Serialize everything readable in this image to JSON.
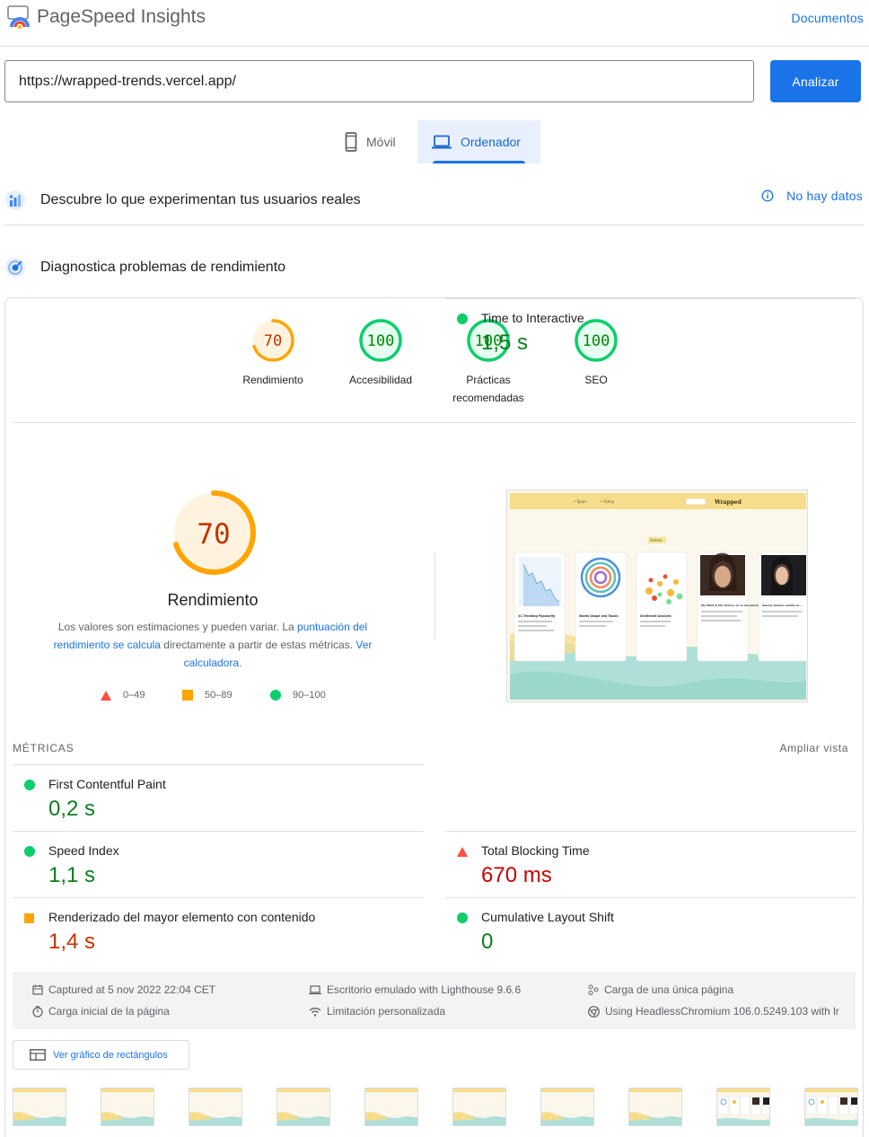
{
  "header": {
    "brand": "PageSpeed Insights",
    "docs_link": "Documentos",
    "colors": {
      "brand_blue": "#1a73e8"
    }
  },
  "search": {
    "url_value": "https://wrapped-trends.vercel.app/",
    "analyze_label": "Analizar"
  },
  "device_tabs": [
    {
      "label": "Móvil",
      "icon": "smartphone-icon",
      "selected": false
    },
    {
      "label": "Ordenador",
      "icon": "laptop-icon",
      "selected": true
    }
  ],
  "field_data": {
    "title": "Descubre lo que experimentan tus usuarios reales",
    "status": "No hay datos",
    "icon": "users-icon"
  },
  "lab_section": {
    "title": "Diagnostica problemas de rendimiento",
    "icon": "gauge-icon"
  },
  "categories": [
    {
      "score": "70",
      "label": "Rendimiento",
      "value": 70,
      "color": "#ffa400"
    },
    {
      "score": "100",
      "label": "Accesibilidad",
      "value": 100,
      "color": "#0cce6b"
    },
    {
      "score": "100",
      "label": "Prácticas recomendadas",
      "value": 100,
      "color": "#0cce6b"
    },
    {
      "score": "100",
      "label": "SEO",
      "value": 100,
      "color": "#0cce6b"
    }
  ],
  "performance": {
    "score": "70",
    "title": "Rendimiento",
    "desc_pre": "Los valores son estimaciones y pueden variar. La ",
    "desc_link1": "puntuación del rendimiento se calcula",
    "desc_mid": " directamente a partir de estas métricas. ",
    "desc_link2": "Ver calculadora.",
    "legend": [
      "0–49",
      "50–89",
      "90–100"
    ]
  },
  "metrics": {
    "title": "MÉTRICAS",
    "expand_label": "Ampliar vista",
    "items": [
      {
        "name": "First Contentful Paint",
        "value": "0,2 s",
        "rating": "pass"
      },
      {
        "name": "Time to Interactive",
        "value": "1,5 s",
        "rating": "pass"
      },
      {
        "name": "Speed Index",
        "value": "1,1 s",
        "rating": "pass"
      },
      {
        "name": "Total Blocking Time",
        "value": "670 ms",
        "rating": "fail"
      },
      {
        "name": "Renderizado del mayor elemento con contenido",
        "value": "1,4 s",
        "rating": "average"
      },
      {
        "name": "Cumulative Layout Shift",
        "value": "0",
        "rating": "pass"
      }
    ]
  },
  "run_info": [
    {
      "text": "Captured at 5 nov 2022 22:04 CET",
      "icon": "calendar-icon"
    },
    {
      "text": "Escritorio emulado with Lighthouse 9.6.6",
      "icon": "laptop-icon"
    },
    {
      "text": "Carga de una única página",
      "icon": "nodes-icon"
    },
    {
      "text": "Carga inicial de la página",
      "icon": "timer-icon"
    },
    {
      "text": "Limitación personalizada",
      "icon": "wifi-icon"
    },
    {
      "text": "Using HeadlessChromium 106.0.5249.103 with lr",
      "icon": "chrome-icon"
    }
  ],
  "treemap_label": "Ver gráfico de rectángulos",
  "screenshot_text": {
    "nav1": "• Spain",
    "nav2": "• Today",
    "brand": "Wrapped",
    "chip": "Selena",
    "cards": [
      "#1 Trending Popularity",
      "Words Usage and Topics",
      "Sentiment Analysis",
      "My Mind & Me: Elenco en el documental de Selena Gom...",
      "Selena Gomez cuenta su..."
    ]
  }
}
